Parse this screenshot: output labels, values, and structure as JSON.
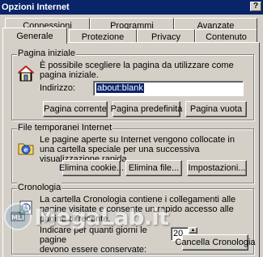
{
  "window": {
    "title": "Opzioni Internet",
    "help_label": "?"
  },
  "tabs": {
    "row_back": [
      "Connessioni",
      "Programmi",
      "Avanzate"
    ],
    "row_front": [
      "Generale",
      "Protezione",
      "Privacy",
      "Contenuto"
    ],
    "active": "Generale"
  },
  "home": {
    "title": "Pagina iniziale",
    "description": "È possibile scegliere la pagina da utilizzare come pagina iniziale.",
    "address_label": "Indirizzo:",
    "address_value": "about:blank",
    "btn_current": "Pagina corrente",
    "btn_default": "Pagina predefinita",
    "btn_blank": "Pagina vuota"
  },
  "temp": {
    "title": "File temporanei Internet",
    "description": "Le pagine aperte su Internet vengono collocate in una cartella speciale per una successiva visualizzazione rapida.",
    "btn_cookies": "Elimina cookie...",
    "btn_files": "Elimina file...",
    "btn_settings": "Impostazioni..."
  },
  "history": {
    "title": "Cronologia",
    "description": "La cartella Cronologia contiene i collegamenti alle pagine visitate e consente un rapido accesso alle pagine di recente.",
    "days_label": "Indicare per quanti giorni le pagine",
    "days_label_2": "devono essere conservate:",
    "days_value": "20",
    "btn_clear": "Cancella Cronologia"
  },
  "watermark": {
    "text": "MegaLab.it"
  }
}
